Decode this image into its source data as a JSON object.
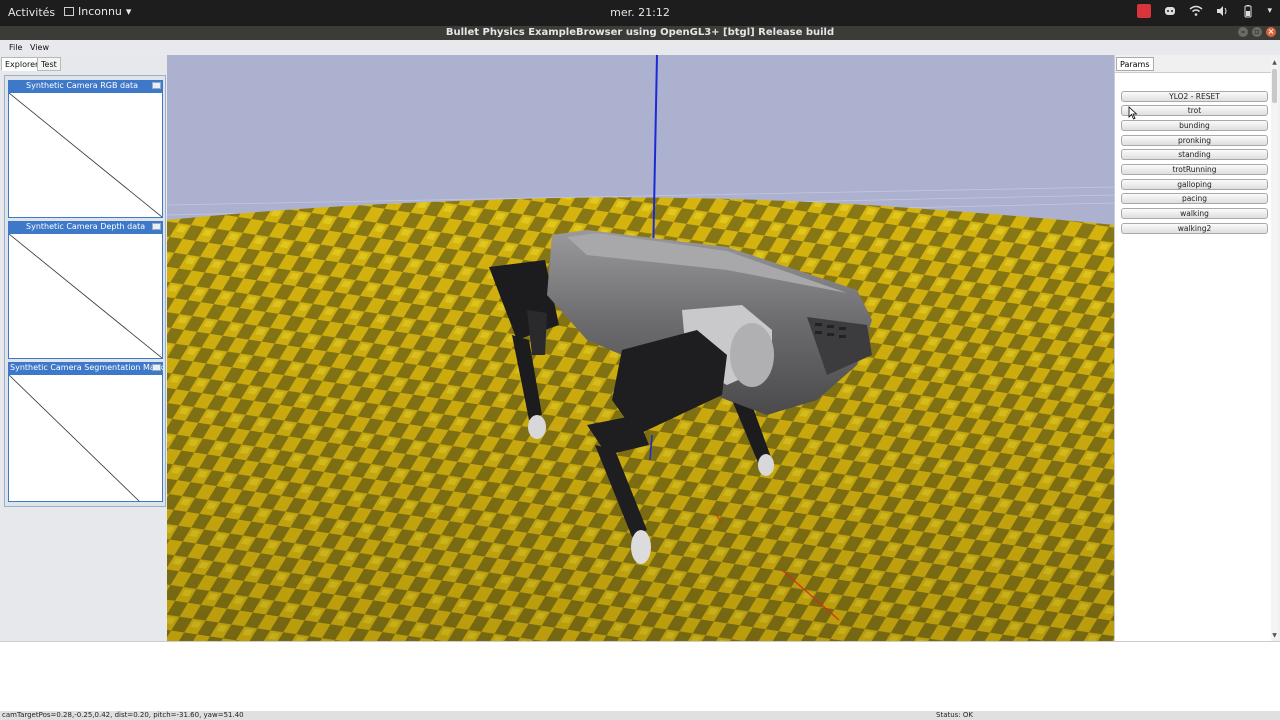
{
  "topbar": {
    "activities": "Activités",
    "app_menu": "Inconnu",
    "clock": "mer. 21:12"
  },
  "window": {
    "title": "Bullet Physics ExampleBrowser using OpenGL3+ [btgl] Release build"
  },
  "menu": {
    "file": "File",
    "view": "View"
  },
  "left_panel": {
    "tabs": [
      {
        "label": "Explorer"
      },
      {
        "label": "Test"
      }
    ],
    "cameras": [
      {
        "label": "Synthetic Camera RGB data"
      },
      {
        "label": "Synthetic Camera Depth data"
      },
      {
        "label": "Synthetic Camera Segmentation Mask"
      }
    ]
  },
  "params_panel": {
    "tab": "Params",
    "buttons": [
      {
        "label": "YLO2 - RESET"
      },
      {
        "label": "trot"
      },
      {
        "label": "bunding"
      },
      {
        "label": "pronking"
      },
      {
        "label": "standing"
      },
      {
        "label": "trotRunning"
      },
      {
        "label": "galloping"
      },
      {
        "label": "pacing"
      },
      {
        "label": "walking"
      },
      {
        "label": "walking2"
      }
    ]
  },
  "status": {
    "camera": "camTargetPos=0.28,-0.25,0.42, dist=0.20, pitch=-31.60, yaw=51.40",
    "status": "Status: OK"
  },
  "colors": {
    "sky": "#adb1d0",
    "terrain_yellow": "#e5c20e",
    "terrain_dark": "#8a7a12",
    "robot_body": "#6e6e70",
    "robot_legs": "#1c1c1e",
    "accent_blue": "#3e78c8"
  }
}
